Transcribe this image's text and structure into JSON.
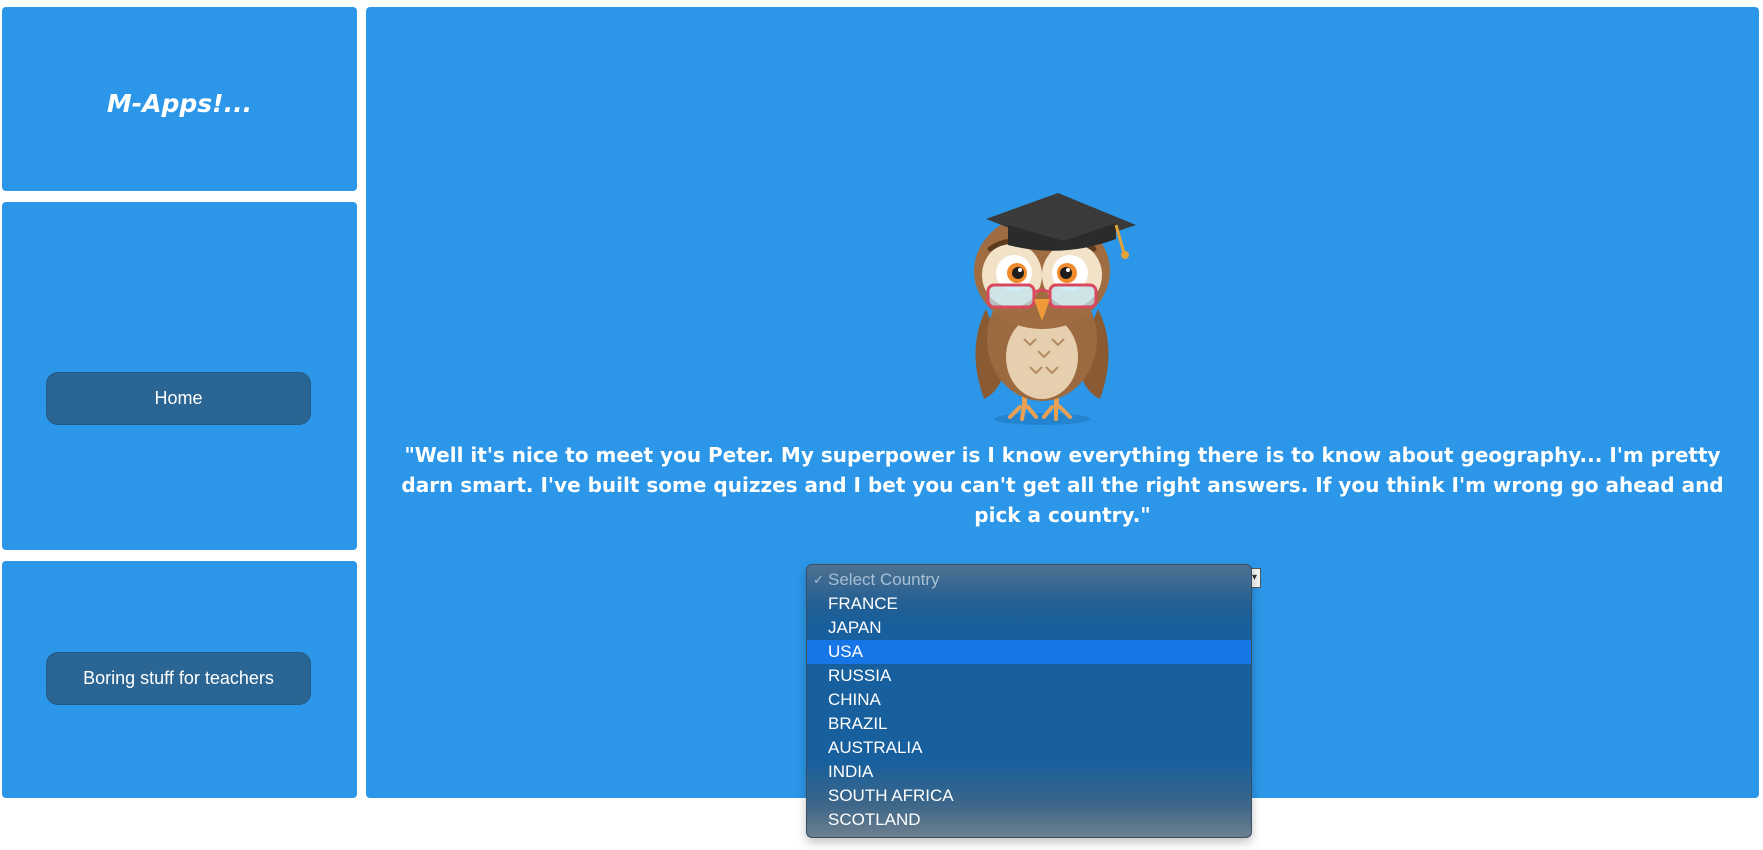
{
  "brand": {
    "title": "M-Apps!..."
  },
  "nav": {
    "home_label": "Home"
  },
  "teachers": {
    "button_label": "Boring stuff for teachers"
  },
  "owl": {
    "speech": "\"Well it's nice to meet you Peter. My superpower is I know everything there is to know about geography... I'm pretty darn smart. I've built some quizzes and I bet you can't get all the right answers. If you think I'm wrong go ahead and pick a country.\""
  },
  "country_select": {
    "placeholder": "Select Country",
    "check_glyph": "✓",
    "highlighted": "USA",
    "options": [
      "FRANCE",
      "JAPAN",
      "USA",
      "RUSSIA",
      "CHINA",
      "BRAZIL",
      "AUSTRALIA",
      "INDIA",
      "SOUTH AFRICA",
      "SCOTLAND"
    ]
  },
  "colors": {
    "panel_blue": "#2c97e8",
    "button_dark": "#2a6593",
    "highlight": "#1676e6"
  },
  "icons": [
    "owl-mascot-icon",
    "graduation-cap-icon",
    "dropdown-arrow-icon",
    "checkmark-icon"
  ]
}
